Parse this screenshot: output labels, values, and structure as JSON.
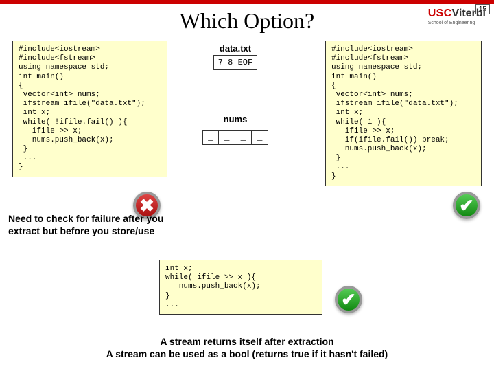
{
  "page_number": "15",
  "brand": {
    "usc": "USC",
    "viterbi": "Viterbi",
    "school": "School of Engineering"
  },
  "title": "Which Option?",
  "code_left": "#include<iostream>\n#include<fstream>\nusing namespace std;\nint main()\n{\n vector<int> nums;\n ifstream ifile(\"data.txt\");\n int x;\n while( !ifile.fail() ){\n   ifile >> x;\n   nums.push_back(x);\n }\n ...\n}",
  "code_right": "#include<iostream>\n#include<fstream>\nusing namespace std;\nint main()\n{\n vector<int> nums;\n ifstream ifile(\"data.txt\");\n int x;\n while( 1 ){\n   ifile >> x;\n   if(ifile.fail()) break;\n   nums.push_back(x);\n }\n ...\n}",
  "data_label": "data.txt",
  "data_contents": "7 8 EOF",
  "nums_label": "nums",
  "nums_cells": [
    "_",
    "_",
    "_",
    "_"
  ],
  "hint_lines": [
    "Need to check for failure after you",
    "extract but before you store/use"
  ],
  "code_bottom": "int x;\nwhile( ifile >> x ){\n   nums.push_back(x);\n}\n...",
  "footer_lines": [
    "A stream returns itself after extraction",
    "A stream can be used as a bool (returns true if it hasn't failed)"
  ],
  "icons": {
    "bad": "✖",
    "good": "✔"
  }
}
